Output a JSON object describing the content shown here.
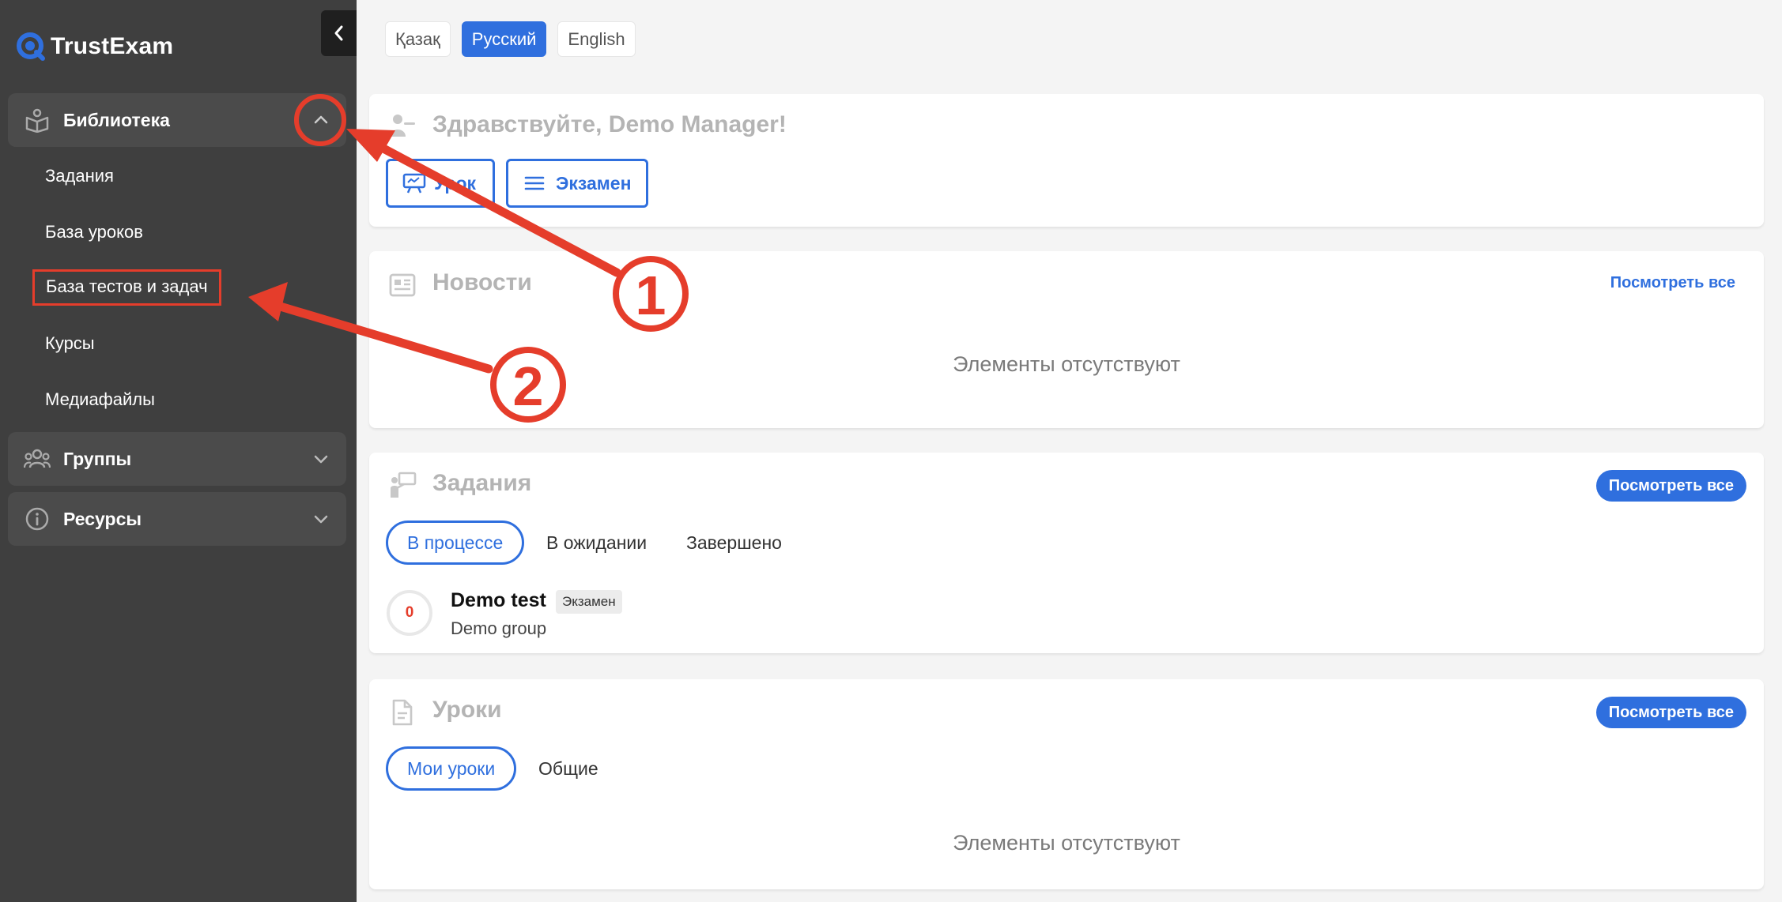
{
  "app": {
    "name": "TrustExam"
  },
  "sidebar": {
    "groups": [
      {
        "label": "Библиотека",
        "expanded": true,
        "items": [
          {
            "label": "Задания"
          },
          {
            "label": "База уроков"
          },
          {
            "label": "База тестов и задач"
          },
          {
            "label": "Курсы"
          },
          {
            "label": "Медиафайлы"
          }
        ]
      },
      {
        "label": "Группы",
        "expanded": false
      },
      {
        "label": "Ресурсы",
        "expanded": false
      }
    ]
  },
  "languages": [
    {
      "label": "Қазақ",
      "active": false
    },
    {
      "label": "Русский",
      "active": true
    },
    {
      "label": "English",
      "active": false
    }
  ],
  "welcome": {
    "title": "Здравствуйте, Demo Manager!",
    "lesson_button": "Урок",
    "exam_button": "Экзамен"
  },
  "news": {
    "title": "Новости",
    "view_all": "Посмотреть все",
    "empty": "Элементы отсутствуют"
  },
  "tasks": {
    "title": "Задания",
    "view_all": "Посмотреть все",
    "tabs": [
      "В процессе",
      "В ожидании",
      "Завершено"
    ],
    "items": [
      {
        "score": "0",
        "title": "Demo test",
        "badge": "Экзамен",
        "group": "Demo group"
      }
    ]
  },
  "lessons": {
    "title": "Уроки",
    "view_all": "Посмотреть все",
    "tabs": [
      "Мои уроки",
      "Общие"
    ],
    "empty": "Элементы отсутствуют"
  },
  "annotations": {
    "step1": "1",
    "step2": "2"
  },
  "colors": {
    "accent": "#2f6fde",
    "sidebar": "#3f3f3f",
    "annotation": "#e53d2b"
  }
}
